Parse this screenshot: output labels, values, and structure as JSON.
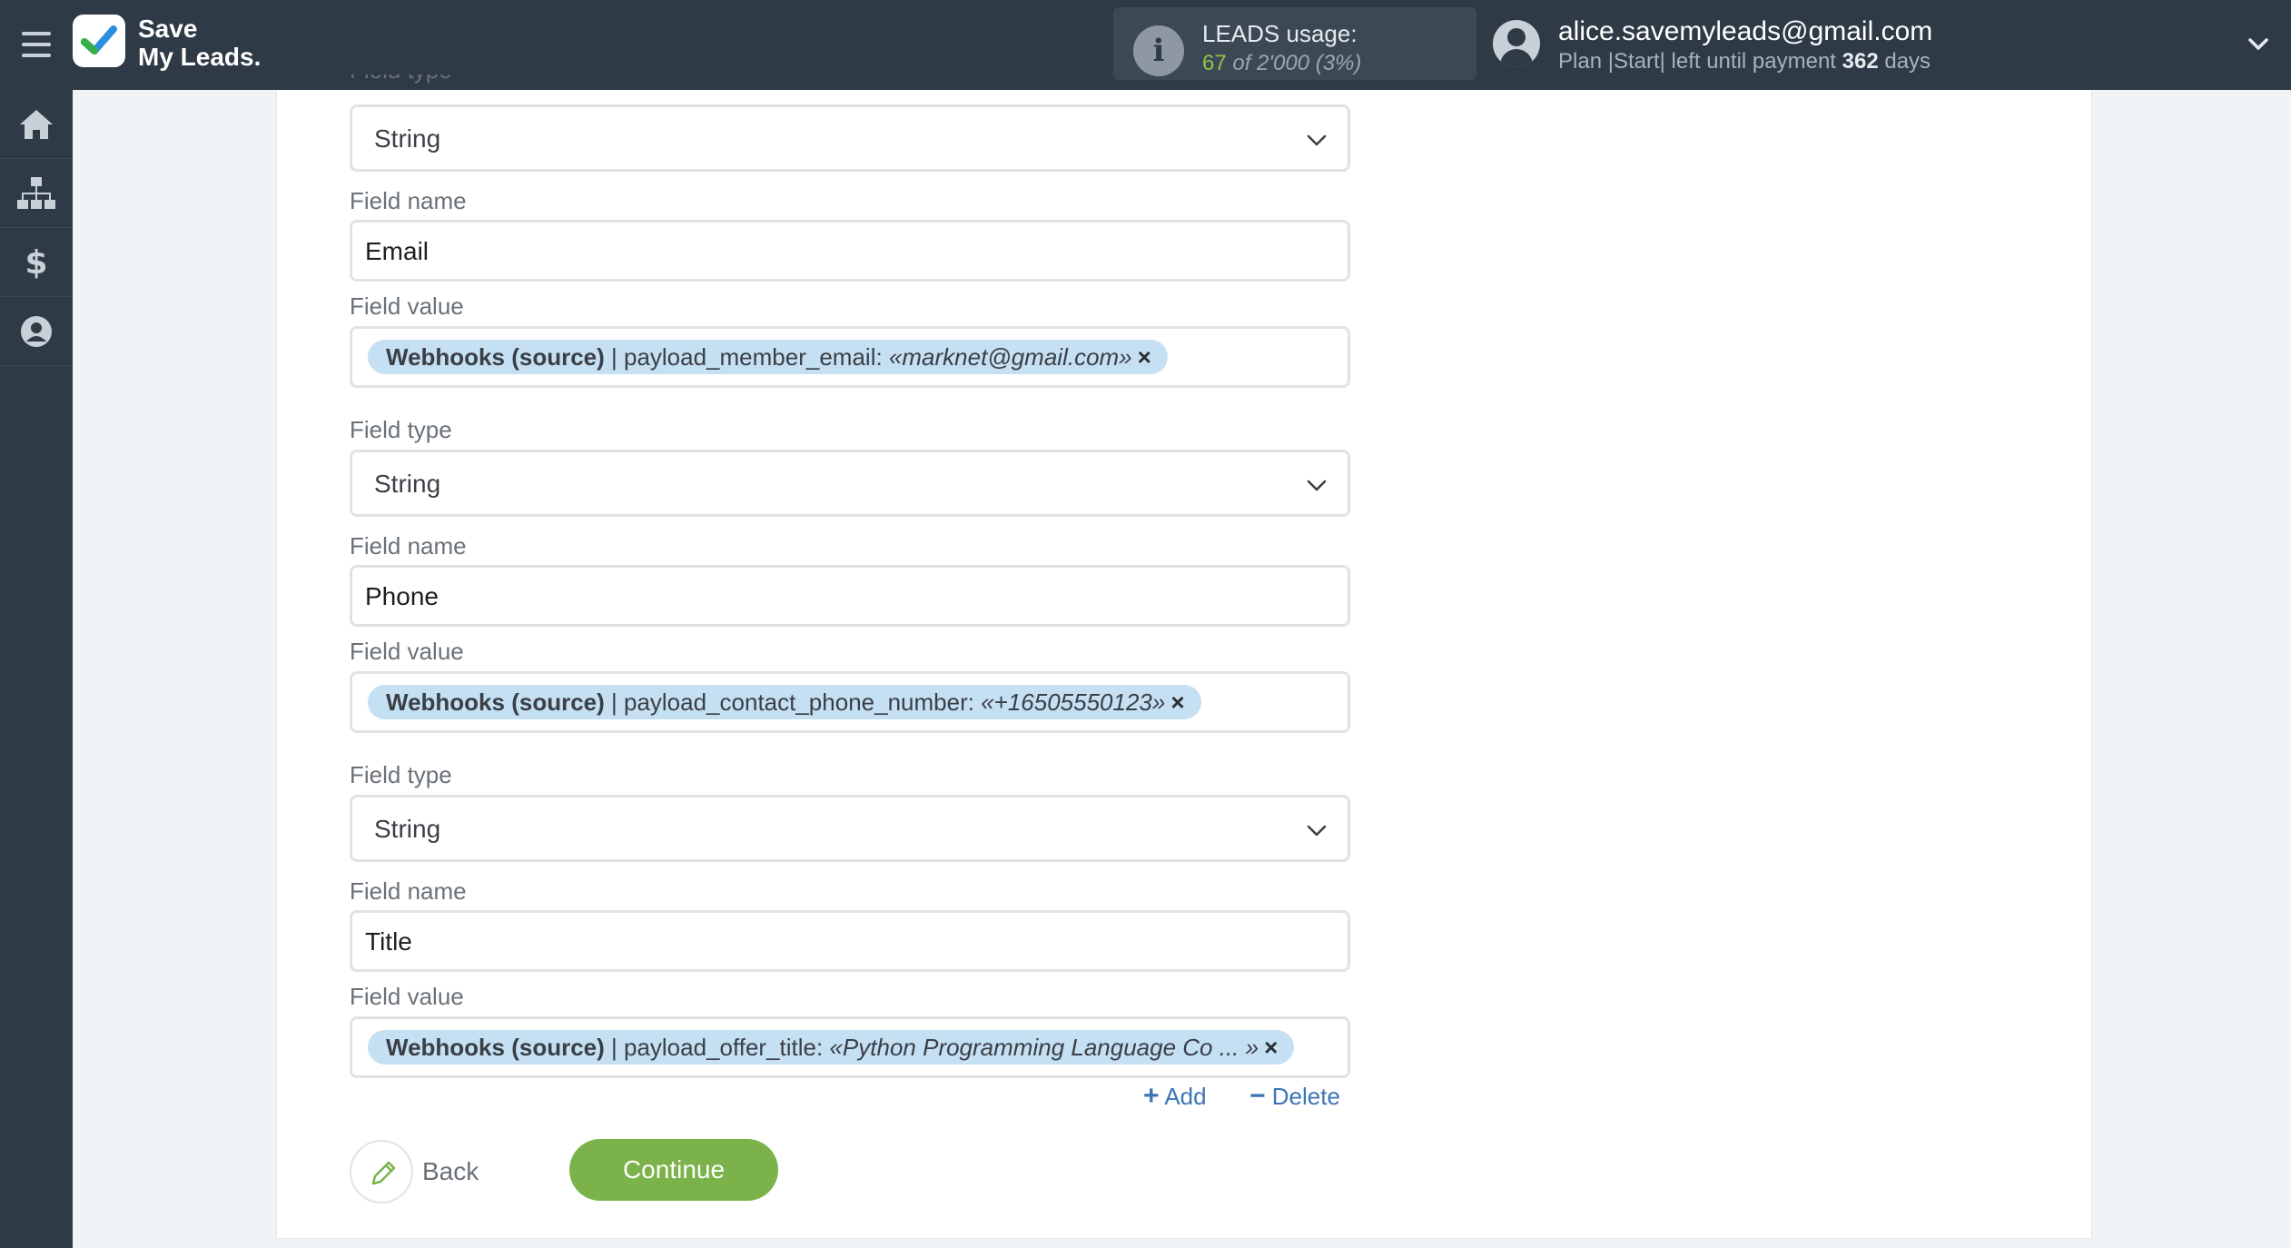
{
  "header": {
    "brand_line1": "Save",
    "brand_line2": "My Leads.",
    "usage_label": "LEADS usage:",
    "usage_used": "67",
    "usage_of": "of 2'000",
    "usage_pct": "(3%)",
    "user_email": "alice.savemyleads@gmail.com",
    "plan_text": "Plan |Start| left until payment",
    "plan_days": "362",
    "plan_days_unit": "days"
  },
  "sidebar": {
    "items": [
      {
        "icon": "home-icon"
      },
      {
        "icon": "sitemap-icon"
      },
      {
        "icon": "dollar-icon"
      },
      {
        "icon": "user-icon"
      }
    ]
  },
  "form": {
    "partial_label": "Field type",
    "field_type_label": "Field type",
    "field_name_label": "Field name",
    "field_value_label": "Field value",
    "fields": [
      {
        "type": "String",
        "name": "Email",
        "tag_source": "Webhooks (source)",
        "tag_sep": " | ",
        "tag_key": "payload_member_email:",
        "tag_value": "«marknet@gmail.com»"
      },
      {
        "type": "String",
        "name": "Phone",
        "tag_source": "Webhooks (source)",
        "tag_sep": " | ",
        "tag_key": "payload_contact_phone_number:",
        "tag_value": "«+16505550123»"
      },
      {
        "type": "String",
        "name": "Title",
        "tag_source": "Webhooks (source)",
        "tag_sep": " | ",
        "tag_key": "payload_offer_title:",
        "tag_value": "«Python Programming Language Co ... »"
      }
    ],
    "add_label": "Add",
    "delete_label": "Delete",
    "back_label": "Back",
    "continue_label": "Continue",
    "tag_remove_glyph": "×"
  },
  "colors": {
    "topbar": "#2e3a46",
    "accent_green": "#7bb34a",
    "link_blue": "#3c74b6",
    "tag_bg": "#c5dff3"
  }
}
